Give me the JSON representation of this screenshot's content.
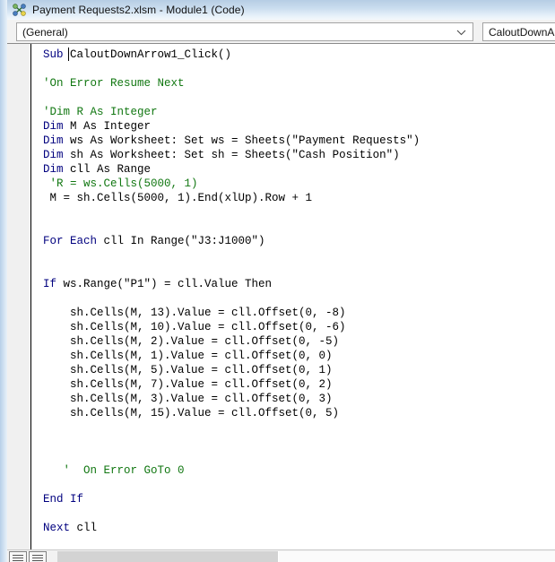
{
  "window": {
    "title": "Payment Requests2.xlsm - Module1 (Code)",
    "icon": "vba-module-icon"
  },
  "toolbar": {
    "object_dropdown": {
      "value": "(General)",
      "icon": "chevron-down-icon"
    },
    "procedure_dropdown": {
      "value": "CaloutDownArr",
      "icon": "chevron-down-icon"
    }
  },
  "code": {
    "lines": [
      {
        "text": "Sub CaloutDownArrow1_Click()",
        "kw": "Sub",
        "rest": " CaloutDownArrow1_Click()",
        "type": "keyword-lead"
      },
      {
        "text": "",
        "type": "blank"
      },
      {
        "text": "'On Error Resume Next",
        "type": "comment"
      },
      {
        "text": "",
        "type": "blank"
      },
      {
        "text": "'Dim R As Integer",
        "type": "comment"
      },
      {
        "text": "Dim M As Integer",
        "kw": "Dim",
        "rest": " M As Integer",
        "type": "keyword-lead"
      },
      {
        "text": "Dim ws As Worksheet: Set ws = Sheets(\"Payment Requests\")",
        "kw": "Dim",
        "rest": " ws As Worksheet: Set ws = Sheets(\"Payment Requests\")",
        "type": "keyword-lead"
      },
      {
        "text": "Dim sh As Worksheet: Set sh = Sheets(\"Cash Position\")",
        "kw": "Dim",
        "rest": " sh As Worksheet: Set sh = Sheets(\"Cash Position\")",
        "type": "keyword-lead"
      },
      {
        "text": "Dim cll As Range",
        "kw": "Dim",
        "rest": " cll As Range",
        "type": "keyword-lead"
      },
      {
        "text": " 'R = ws.Cells(5000, 1)",
        "type": "comment"
      },
      {
        "text": " M = sh.Cells(5000, 1).End(xlUp).Row + 1",
        "type": "plain"
      },
      {
        "text": "",
        "type": "blank"
      },
      {
        "text": "",
        "type": "blank"
      },
      {
        "text": "For Each cll In Range(\"J3:J1000\")",
        "kw": "For Each",
        "rest": " cll In Range(\"J3:J1000\")",
        "type": "keyword-lead"
      },
      {
        "text": "",
        "type": "blank"
      },
      {
        "text": "",
        "type": "blank"
      },
      {
        "text": "If ws.Range(\"P1\") = cll.Value Then",
        "kw": "If",
        "rest": " ws.Range(\"P1\") = cll.Value Then",
        "type": "keyword-lead"
      },
      {
        "text": "",
        "type": "blank"
      },
      {
        "text": "    sh.Cells(M, 13).Value = cll.Offset(0, -8)",
        "type": "plain"
      },
      {
        "text": "    sh.Cells(M, 10).Value = cll.Offset(0, -6)",
        "type": "plain"
      },
      {
        "text": "    sh.Cells(M, 2).Value = cll.Offset(0, -5)",
        "type": "plain"
      },
      {
        "text": "    sh.Cells(M, 1).Value = cll.Offset(0, 0)",
        "type": "plain"
      },
      {
        "text": "    sh.Cells(M, 5).Value = cll.Offset(0, 1)",
        "type": "plain"
      },
      {
        "text": "    sh.Cells(M, 7).Value = cll.Offset(0, 2)",
        "type": "plain"
      },
      {
        "text": "    sh.Cells(M, 3).Value = cll.Offset(0, 3)",
        "type": "plain"
      },
      {
        "text": "    sh.Cells(M, 15).Value = cll.Offset(0, 5)",
        "type": "plain"
      },
      {
        "text": "",
        "type": "blank"
      },
      {
        "text": "",
        "type": "blank"
      },
      {
        "text": "",
        "type": "blank"
      },
      {
        "text": "   '  On Error GoTo 0",
        "type": "comment"
      },
      {
        "text": "",
        "type": "blank"
      },
      {
        "text": "End If",
        "kw": "End If",
        "rest": "",
        "type": "keyword-lead"
      },
      {
        "text": "",
        "type": "blank"
      },
      {
        "text": "Next cll",
        "kw": "Next",
        "rest": " cll",
        "type": "keyword-lead"
      }
    ]
  },
  "statusbar": {
    "procedure_view_button": "procedure-view",
    "full_module_view_button": "full-module-view"
  },
  "colors": {
    "keyword": "#00007f",
    "comment": "#117711",
    "text": "#000000",
    "titlebar_top": "#b6cde4",
    "gutter": "#f0f0f0"
  }
}
